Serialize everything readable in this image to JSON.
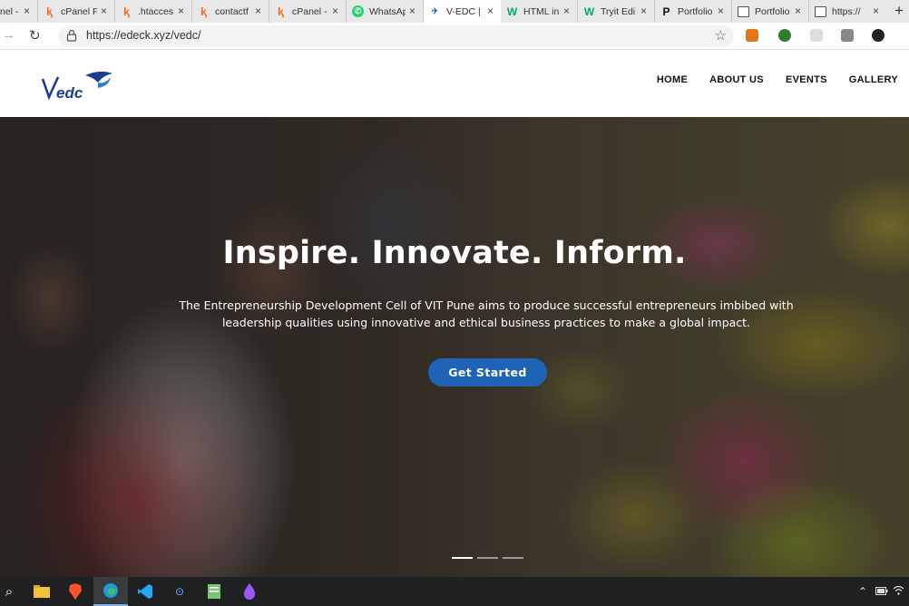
{
  "browser": {
    "tabs": [
      {
        "label": "nel -",
        "favicon": "cpanel-icon",
        "active": false
      },
      {
        "label": "cPanel F",
        "favicon": "cpanel-icon",
        "active": false
      },
      {
        "label": ".htacces",
        "favicon": "cpanel-icon",
        "active": false
      },
      {
        "label": "contactf",
        "favicon": "cpanel-icon",
        "active": false
      },
      {
        "label": "cPanel -",
        "favicon": "cpanel-icon",
        "active": false
      },
      {
        "label": "WhatsAp",
        "favicon": "whatsapp-icon",
        "active": false
      },
      {
        "label": "V-EDC |",
        "favicon": "vedc-icon",
        "active": true
      },
      {
        "label": "HTML in",
        "favicon": "w3schools-icon",
        "active": false
      },
      {
        "label": "Tryit Edi",
        "favicon": "w3schools-icon",
        "active": false
      },
      {
        "label": "Portfolio",
        "favicon": "p-icon",
        "active": false
      },
      {
        "label": "Portfolio",
        "favicon": "document-icon",
        "active": false
      },
      {
        "label": "https://",
        "favicon": "document-icon",
        "active": false
      }
    ],
    "new_tab_glyph": "+",
    "tab_close_glyph": "×",
    "url": "https://edeck.xyz/vedc/"
  },
  "site": {
    "logo_text": "Vedc",
    "nav": [
      "HOME",
      "ABOUT US",
      "EVENTS",
      "GALLERY"
    ]
  },
  "hero": {
    "title": "Inspire. Innovate. Inform.",
    "description": "The Entrepreneurship Development Cell of VIT Pune aims to produce successful entrepreneurs imbibed with leadership qualities using innovative and ethical business practices to make a global impact.",
    "cta_label": "Get Started",
    "carousel_slides": 3,
    "active_slide": 1
  },
  "colors": {
    "cta": "#1e63b6",
    "logo_blue": "#1a3f8f",
    "logo_light": "#2a7fd4"
  },
  "taskbar": {
    "apps": [
      "search-icon",
      "file-explorer-icon",
      "brave-icon",
      "edge-icon",
      "vscode-icon",
      "app-icon",
      "notepad-icon",
      "dropper-icon"
    ],
    "tray": [
      "chevron-up-icon",
      "battery-icon",
      "wifi-icon"
    ]
  }
}
